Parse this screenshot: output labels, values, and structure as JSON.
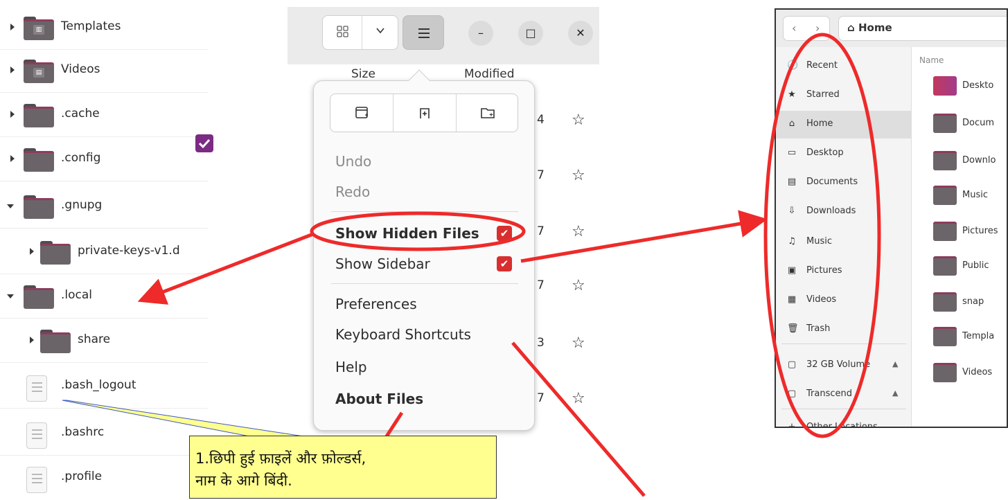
{
  "tree": {
    "rows": [
      {
        "label": "Templates",
        "kind": "folder",
        "emblem": "templates"
      },
      {
        "label": "Videos",
        "kind": "folder",
        "emblem": "videos"
      },
      {
        "label": ".cache",
        "kind": "folder"
      },
      {
        "label": ".config",
        "kind": "folder"
      },
      {
        "label": ".gnupg",
        "kind": "folder",
        "expanded": true
      },
      {
        "label": "private-keys-v1.d",
        "kind": "folder",
        "child": true
      },
      {
        "label": ".local",
        "kind": "folder",
        "expanded": true
      },
      {
        "label": "share",
        "kind": "folder",
        "child": true
      },
      {
        "label": ".bash_logout",
        "kind": "file"
      },
      {
        "label": ".bashrc",
        "kind": "file"
      },
      {
        "label": ".profile",
        "kind": "file"
      }
    ]
  },
  "header": {
    "grid_icon": "grid-view-icon",
    "chevron": "⌄",
    "minimize": "–",
    "maximize": "□",
    "close": "✕"
  },
  "columns": {
    "size": "Size",
    "modified": "Modified"
  },
  "bg_rows": [
    {
      "num": "4"
    },
    {
      "num": "7"
    },
    {
      "num": "7"
    },
    {
      "num": "7"
    },
    {
      "num": "3"
    },
    {
      "num": "7"
    }
  ],
  "menu": {
    "buttons": [
      "new-window-icon",
      "new-tab-icon",
      "new-folder-icon"
    ],
    "undo": "Undo",
    "redo": "Redo",
    "show_hidden": "Show Hidden Files",
    "show_sidebar": "Show Sidebar",
    "preferences": "Preferences",
    "shortcuts": "Keyboard Shortcuts",
    "help": "Help",
    "about": "About Files",
    "show_hidden_checked": true,
    "show_sidebar_checked": true
  },
  "files_window": {
    "back": "‹",
    "forward": "›",
    "location": "Home",
    "sidebar": [
      {
        "icon": "🕓",
        "label": "Recent"
      },
      {
        "icon": "★",
        "label": "Starred"
      },
      {
        "icon": "⌂",
        "label": "Home",
        "active": true
      },
      {
        "icon": "▭",
        "label": "Desktop"
      },
      {
        "icon": "▤",
        "label": "Documents"
      },
      {
        "icon": "⇩",
        "label": "Downloads"
      },
      {
        "icon": "♫",
        "label": "Music"
      },
      {
        "icon": "▣",
        "label": "Pictures"
      },
      {
        "icon": "▦",
        "label": "Videos"
      },
      {
        "icon": "🗑",
        "label": "Trash"
      },
      {
        "icon": "▢",
        "label": "32 GB Volume",
        "eject": "▲"
      },
      {
        "icon": "▢",
        "label": "Transcend",
        "eject": "▲"
      },
      {
        "icon": "+",
        "label": "Other Locations"
      }
    ],
    "name_header": "Name",
    "content": [
      "Deskto",
      "Docum",
      "Downlo",
      "Music",
      "Pictures",
      "Public",
      "snap",
      "Templa",
      "Videos"
    ]
  },
  "callout": {
    "line1": "1.छिपी हुई फ़ाइलें और फ़ोल्डर्स,",
    "line2": "नाम के आगे बिंदी."
  },
  "colors": {
    "annotation_red": "#ee2a2a",
    "check_red": "#d72f2f",
    "callout_yellow": "#ffff8f",
    "badge_purple": "#7b2b83"
  }
}
